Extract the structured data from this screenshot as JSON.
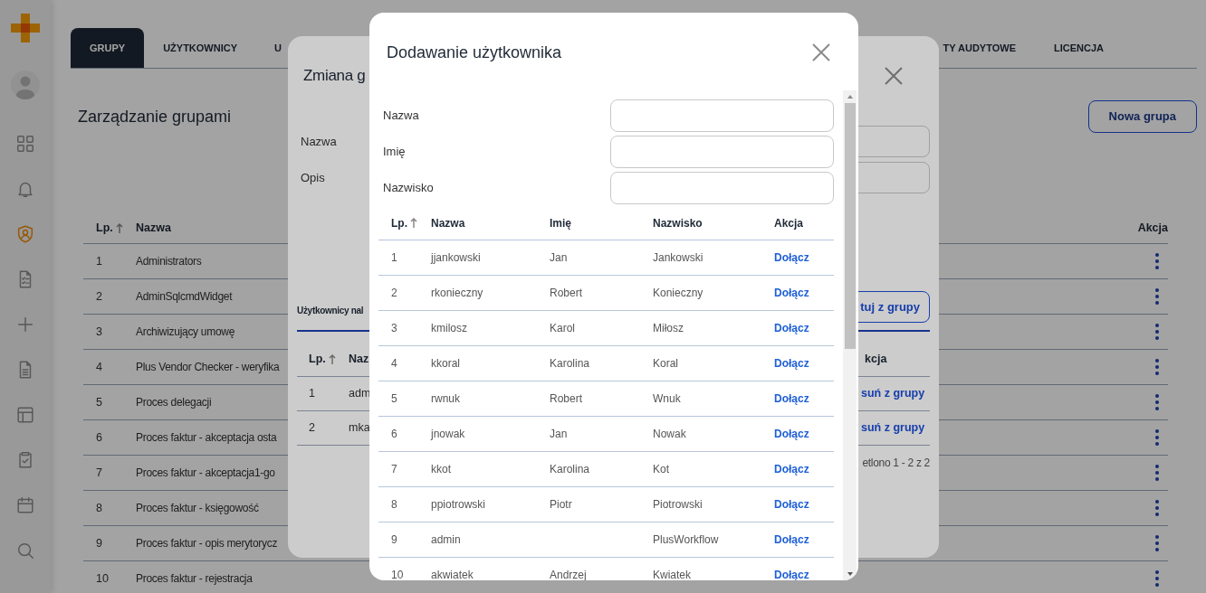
{
  "sidebar": {
    "items": [
      {
        "selected": false
      },
      {
        "selected": false
      },
      {
        "selected": true
      },
      {
        "selected": false
      },
      {
        "selected": false
      },
      {
        "selected": false
      },
      {
        "selected": false
      },
      {
        "selected": false
      },
      {
        "selected": false
      },
      {
        "selected": false
      }
    ]
  },
  "tabs": [
    {
      "label": "GRUPY",
      "selected": true
    },
    {
      "label": "UŻYTKOWNICY",
      "selected": false
    },
    {
      "label": "U",
      "selected": false
    },
    {
      "label": "TY AUDYTOWE",
      "selected": false
    },
    {
      "label": "LICENCJA",
      "selected": false
    }
  ],
  "page": {
    "title": "Zarządzanie grupami",
    "new_button": "Nowa grupa"
  },
  "groups_table": {
    "columns": [
      "Lp.",
      "Nazwa",
      "Akcja"
    ],
    "rows": [
      {
        "lp": "1",
        "name": "Administrators"
      },
      {
        "lp": "2",
        "name": "AdminSqlcmdWidget"
      },
      {
        "lp": "3",
        "name": "Archiwizujący umowę"
      },
      {
        "lp": "4",
        "name": "Plus Vendor Checker - weryfika"
      },
      {
        "lp": "5",
        "name": "Proces delegacji"
      },
      {
        "lp": "6",
        "name": "Proces faktur - akceptacja osta"
      },
      {
        "lp": "7",
        "name": "Proces faktur - akceptacja1-go"
      },
      {
        "lp": "8",
        "name": "Proces faktur - księgowość"
      },
      {
        "lp": "9",
        "name": "Proces faktur - opis merytorycz"
      },
      {
        "lp": "10",
        "name": "Proces faktur - rejestracja"
      }
    ]
  },
  "edit_group_dialog": {
    "title": "Zmiana g",
    "fields": [
      "Nazwa",
      "Opis"
    ],
    "members_tab": "Użytkownicy nal",
    "remove_button": "tuj z grupy",
    "table": {
      "columns": [
        "Lp.",
        "Naz",
        "kcja"
      ],
      "rows": [
        {
          "lp": "1",
          "name": "adm",
          "action": "suń z grupy"
        },
        {
          "lp": "2",
          "name": "mka",
          "action": "suń z grupy"
        }
      ]
    },
    "footer": "etlono 1 - 2 z 2"
  },
  "add_user_dialog": {
    "title": "Dodawanie użytkownika",
    "fields": [
      "Nazwa",
      "Imię",
      "Nazwisko"
    ],
    "table": {
      "columns": [
        "Lp.",
        "Nazwa",
        "Imię",
        "Nazwisko",
        "Akcja"
      ],
      "rows": [
        {
          "lp": "1",
          "login": "jjankowski",
          "first_name": "Jan",
          "last_name": "Jankowski",
          "action": "Dołącz"
        },
        {
          "lp": "2",
          "login": "rkonieczny",
          "first_name": "Robert",
          "last_name": "Konieczny",
          "action": "Dołącz"
        },
        {
          "lp": "3",
          "login": "kmilosz",
          "first_name": "Karol",
          "last_name": "Miłosz",
          "action": "Dołącz"
        },
        {
          "lp": "4",
          "login": "kkoral",
          "first_name": "Karolina",
          "last_name": "Koral",
          "action": "Dołącz"
        },
        {
          "lp": "5",
          "login": "rwnuk",
          "first_name": "Robert",
          "last_name": "Wnuk",
          "action": "Dołącz"
        },
        {
          "lp": "6",
          "login": "jnowak",
          "first_name": "Jan",
          "last_name": "Nowak",
          "action": "Dołącz"
        },
        {
          "lp": "7",
          "login": "kkot",
          "first_name": "Karolina",
          "last_name": "Kot",
          "action": "Dołącz"
        },
        {
          "lp": "8",
          "login": "ppiotrowski",
          "first_name": "Piotr",
          "last_name": "Piotrowski",
          "action": "Dołącz"
        },
        {
          "lp": "9",
          "login": "admin",
          "last_name": "PlusWorkflow",
          "action": "Dołącz"
        },
        {
          "lp": "10",
          "login": "akwiatek",
          "first_name": "Andrzej",
          "last_name": "Kwiatek",
          "action": "Dołącz"
        }
      ]
    }
  }
}
